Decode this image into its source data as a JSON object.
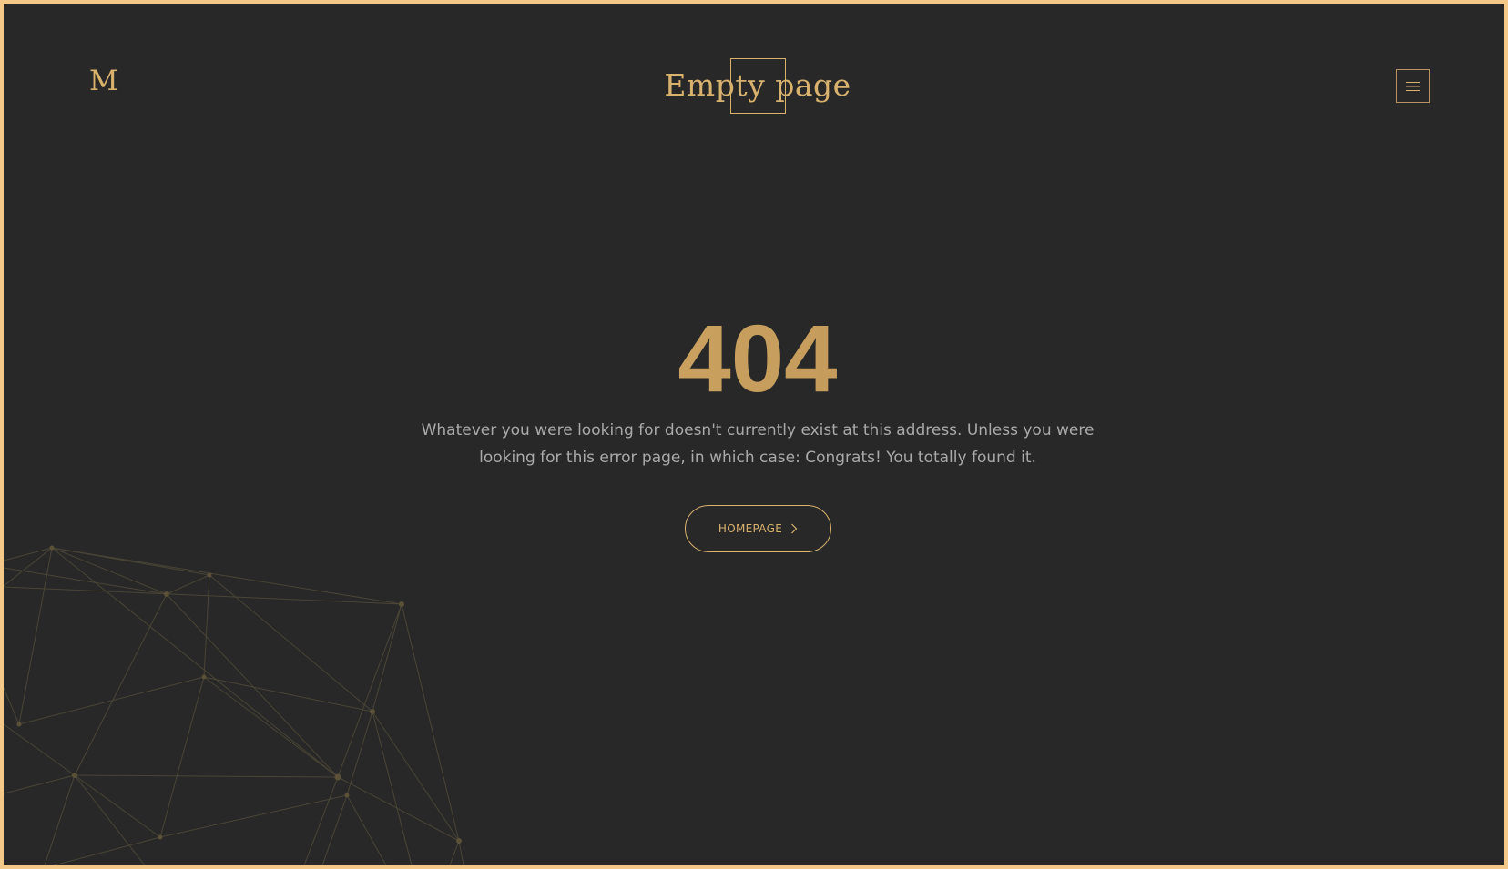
{
  "header": {
    "logo": "M",
    "title": "Empty page",
    "menu_icon": "hamburger-menu-icon"
  },
  "error": {
    "code": "404",
    "message": "Whatever you were looking for doesn't currently exist at this address. Unless you were looking for this error page, in which case: Congrats! You totally found it."
  },
  "actions": {
    "homepage_label": "HOMEPAGE",
    "homepage_icon": "chevron-right-icon"
  },
  "colors": {
    "outer_frame": "#f3c889",
    "background": "#282828",
    "accent": "#d9b26e",
    "body_text": "#a9a9a9"
  }
}
